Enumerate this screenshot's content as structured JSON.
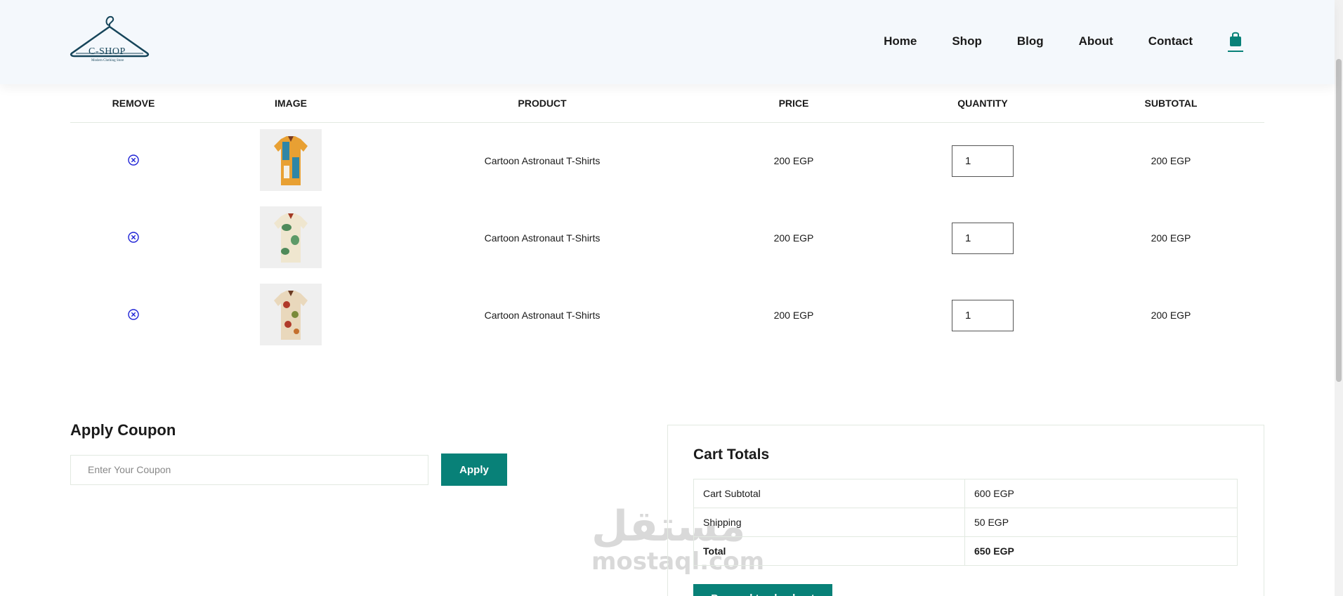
{
  "brand": {
    "name": "C-SHOP",
    "tagline": "Modern Clothing Store",
    "accent_color": "#088178"
  },
  "nav": {
    "items": [
      "Home",
      "Shop",
      "Blog",
      "About",
      "Contact"
    ],
    "cart_icon": "shopping-bag-icon"
  },
  "cart_table": {
    "headers": [
      "REMOVE",
      "IMAGE",
      "PRODUCT",
      "PRICE",
      "QUANTITY",
      "SUBTOTAL"
    ],
    "rows": [
      {
        "product": "Cartoon Astronaut T-Shirts",
        "price": "200 EGP",
        "quantity": "1",
        "subtotal": "200 EGP",
        "image": "shirt-orange-blue"
      },
      {
        "product": "Cartoon Astronaut T-Shirts",
        "price": "200 EGP",
        "quantity": "1",
        "subtotal": "200 EGP",
        "image": "shirt-cream-green"
      },
      {
        "product": "Cartoon Astronaut T-Shirts",
        "price": "200 EGP",
        "quantity": "1",
        "subtotal": "200 EGP",
        "image": "shirt-beige-red"
      }
    ]
  },
  "coupon": {
    "title": "Apply Coupon",
    "placeholder": "Enter Your Coupon",
    "button_label": "Apply"
  },
  "totals": {
    "title": "Cart Totals",
    "rows": [
      {
        "label": "Cart Subtotal",
        "value": "600 EGP"
      },
      {
        "label": "Shipping",
        "value": "50 EGP"
      },
      {
        "label": "Total",
        "value": "650 EGP"
      }
    ],
    "checkout_label": "Proceed to checkout"
  },
  "watermark": {
    "arabic": "مستقل",
    "latin": "mostaql.com"
  }
}
